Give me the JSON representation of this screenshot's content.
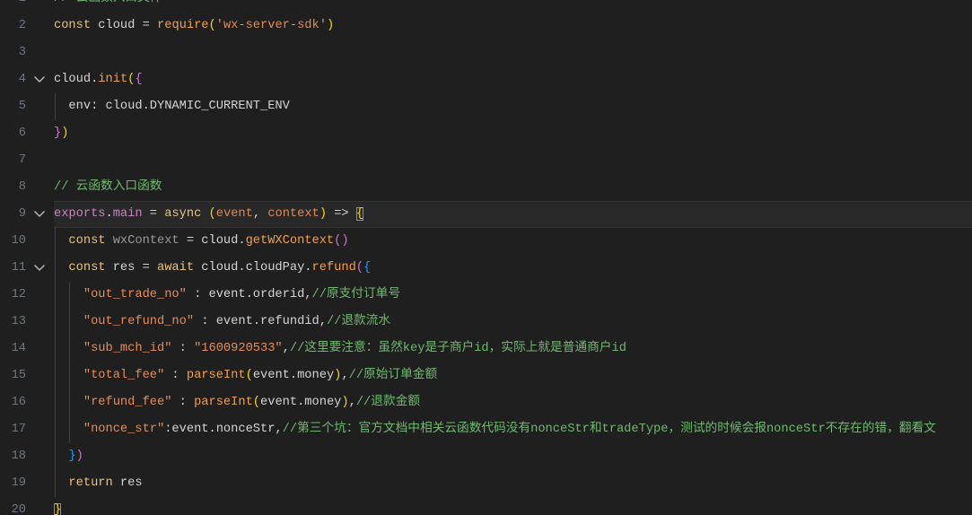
{
  "editor": {
    "theme": {
      "background": "#1f1f1f",
      "line_number": "#6e7681",
      "text": "#d4d4d4"
    },
    "cursor_line": 9,
    "lines": [
      {
        "number": "1",
        "tokens": [
          {
            "text": "// 云函数入口文件",
            "color": "#6fb86f"
          }
        ]
      },
      {
        "number": "2",
        "tokens": [
          {
            "text": "const",
            "color": "#e6c384"
          },
          {
            "text": " cloud = "
          },
          {
            "text": "require",
            "color": "#efa04c",
            "hint": true
          },
          {
            "text": "(",
            "color": "#ffd700"
          },
          {
            "text": "'wx-server-sdk'",
            "color": "#e38c5d"
          },
          {
            "text": ")",
            "color": "#ffd700"
          }
        ]
      },
      {
        "number": "3",
        "tokens": []
      },
      {
        "number": "4",
        "fold_icon": "chevron-down-icon",
        "tokens": [
          {
            "text": "cloud."
          },
          {
            "text": "init",
            "color": "#efa04c"
          },
          {
            "text": "(",
            "color": "#ffd700"
          },
          {
            "text": "{",
            "color": "#da70d6"
          }
        ]
      },
      {
        "number": "5",
        "tokens": [
          {
            "text": "  env: cloud.DYNAMIC_CURRENT_ENV"
          }
        ]
      },
      {
        "number": "6",
        "tokens": [
          {
            "text": "}",
            "color": "#da70d6"
          },
          {
            "text": ")",
            "color": "#ffd700"
          }
        ]
      },
      {
        "number": "7",
        "tokens": []
      },
      {
        "number": "8",
        "tokens": [
          {
            "text": "// 云函数入口函数",
            "color": "#6fb86f"
          }
        ]
      },
      {
        "number": "9",
        "fold_icon": "chevron-down-icon",
        "tokens": [
          {
            "text": "exports",
            "color": "#c586c0"
          },
          {
            "text": "."
          },
          {
            "text": "main",
            "color": "#c586c0"
          },
          {
            "text": " = "
          },
          {
            "text": "async",
            "color": "#e6c384"
          },
          {
            "text": " "
          },
          {
            "text": "(",
            "color": "#ffd700"
          },
          {
            "text": "event",
            "color": "#d98b5b"
          },
          {
            "text": ", "
          },
          {
            "text": "context",
            "color": "#d98b5b"
          },
          {
            "text": ")",
            "color": "#ffd700"
          },
          {
            "text": " => "
          },
          {
            "text": "{",
            "color": "#ffd700",
            "match": true
          }
        ]
      },
      {
        "number": "10",
        "tokens": [
          {
            "text": "  const",
            "color": "#e6c384"
          },
          {
            "text": " wxContext",
            "color": "#9a9a9a"
          },
          {
            "text": " = cloud."
          },
          {
            "text": "getWXContext",
            "color": "#efa04c"
          },
          {
            "text": "()",
            "color": "#da70d6"
          }
        ]
      },
      {
        "number": "11",
        "fold_icon": "chevron-down-icon",
        "tokens": [
          {
            "text": "  const",
            "color": "#e6c384"
          },
          {
            "text": " res = "
          },
          {
            "text": "await",
            "color": "#e6c384"
          },
          {
            "text": " cloud.cloudPay."
          },
          {
            "text": "refund",
            "color": "#efa04c"
          },
          {
            "text": "(",
            "color": "#da70d6"
          },
          {
            "text": "{",
            "color": "#179fff"
          }
        ]
      },
      {
        "number": "12",
        "tokens": [
          {
            "text": "    \"out_trade_no\"",
            "color": "#e38c5d"
          },
          {
            "text": " : event.orderid,"
          },
          {
            "text": "//原支付订单号",
            "color": "#6fb86f"
          }
        ]
      },
      {
        "number": "13",
        "tokens": [
          {
            "text": "    \"out_refund_no\"",
            "color": "#e38c5d"
          },
          {
            "text": " : event.refundid,"
          },
          {
            "text": "//退款流水",
            "color": "#6fb86f"
          }
        ]
      },
      {
        "number": "14",
        "tokens": [
          {
            "text": "    \"sub_mch_id\"",
            "color": "#e38c5d"
          },
          {
            "text": " : "
          },
          {
            "text": "\"1600920533\"",
            "color": "#e38c5d"
          },
          {
            "text": ","
          },
          {
            "text": "//这里要注意：虽然key是子商户id，实际上就是普通商户id",
            "color": "#6fb86f"
          }
        ]
      },
      {
        "number": "15",
        "tokens": [
          {
            "text": "    \"total_fee\"",
            "color": "#e38c5d"
          },
          {
            "text": " : "
          },
          {
            "text": "parseInt",
            "color": "#efa04c"
          },
          {
            "text": "(",
            "color": "#ffd700"
          },
          {
            "text": "event.money"
          },
          {
            "text": ")",
            "color": "#ffd700"
          },
          {
            "text": ","
          },
          {
            "text": "//原始订单金额",
            "color": "#6fb86f"
          }
        ]
      },
      {
        "number": "16",
        "tokens": [
          {
            "text": "    \"refund_fee\"",
            "color": "#e38c5d"
          },
          {
            "text": " : "
          },
          {
            "text": "parseInt",
            "color": "#efa04c"
          },
          {
            "text": "(",
            "color": "#ffd700"
          },
          {
            "text": "event.money"
          },
          {
            "text": ")",
            "color": "#ffd700"
          },
          {
            "text": ","
          },
          {
            "text": "//退款金额",
            "color": "#6fb86f"
          }
        ]
      },
      {
        "number": "17",
        "tokens": [
          {
            "text": "    \"nonce_str\"",
            "color": "#e38c5d"
          },
          {
            "text": ":event.nonceStr,"
          },
          {
            "text": "//第三个坑：官方文档中相关云函数代码没有nonceStr和tradeType，测试的时候会报nonceStr不存在的错，翻看文",
            "color": "#6fb86f"
          }
        ]
      },
      {
        "number": "18",
        "tokens": [
          {
            "text": "  }",
            "color": "#179fff"
          },
          {
            "text": ")",
            "color": "#da70d6"
          }
        ]
      },
      {
        "number": "19",
        "tokens": [
          {
            "text": "  return",
            "color": "#e6c384"
          },
          {
            "text": " res"
          }
        ]
      },
      {
        "number": "20",
        "tokens": [
          {
            "text": "}",
            "color": "#ffd700",
            "match": true
          }
        ]
      }
    ]
  }
}
